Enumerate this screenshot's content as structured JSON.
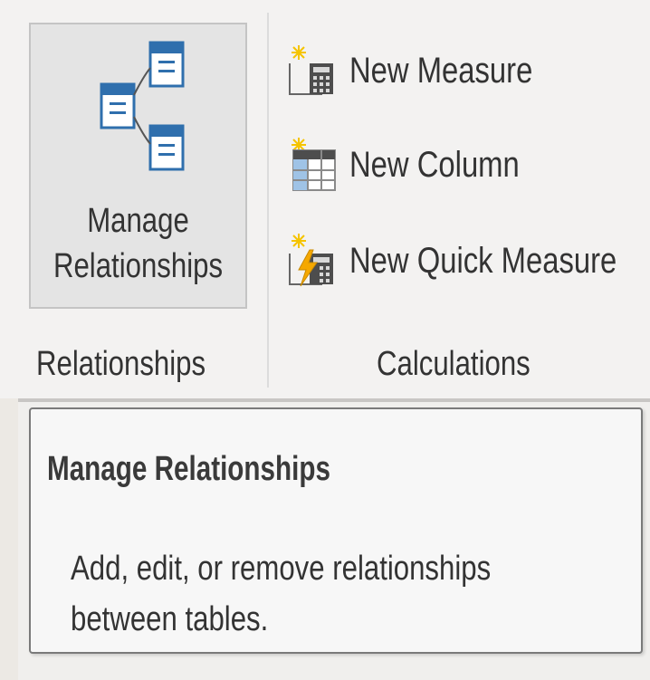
{
  "ribbon": {
    "relationships_group": {
      "manage_button": {
        "line1": "Manage",
        "line2": "Relationships",
        "icon": "relationships-icon"
      },
      "group_label": "Relationships"
    },
    "calculations_group": {
      "commands": [
        {
          "label": "New Measure",
          "icon": "new-measure-icon"
        },
        {
          "label": "New Column",
          "icon": "new-column-icon"
        },
        {
          "label": "New Quick Measure",
          "icon": "new-quick-measure-icon"
        }
      ],
      "group_label": "Calculations"
    }
  },
  "tooltip": {
    "title": "Manage Relationships",
    "line1": "Add, edit, or remove relationships",
    "line2": "between tables."
  },
  "colors": {
    "icon_blue": "#2f6fad",
    "icon_yellow": "#f5c400",
    "icon_gray": "#5a5a5a"
  }
}
